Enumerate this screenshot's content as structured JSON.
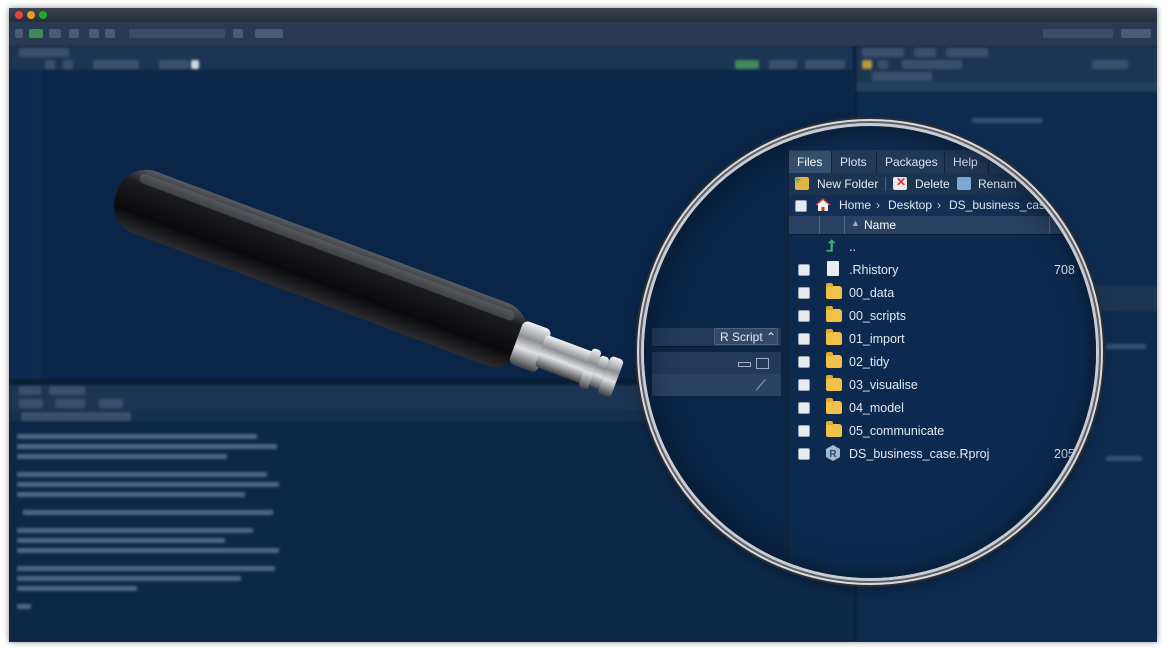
{
  "files_pane": {
    "tabs": [
      "Files",
      "Plots",
      "Packages",
      "Help"
    ],
    "toolbar": {
      "new_folder": "New Folder",
      "delete": "Delete",
      "rename": "Renam"
    },
    "breadcrumb": [
      "Home",
      "Desktop",
      "DS_business_case"
    ],
    "column_header": {
      "name": "Name"
    },
    "rows": [
      {
        "name": "..",
        "size": "",
        "icon": "up-arrow-icon"
      },
      {
        "name": ".Rhistory",
        "size": "708",
        "icon": "document-icon"
      },
      {
        "name": "00_data",
        "size": "",
        "icon": "folder-icon"
      },
      {
        "name": "00_scripts",
        "size": "",
        "icon": "folder-icon"
      },
      {
        "name": "01_import",
        "size": "",
        "icon": "folder-icon"
      },
      {
        "name": "02_tidy",
        "size": "",
        "icon": "folder-icon"
      },
      {
        "name": "03_visualise",
        "size": "",
        "icon": "folder-icon"
      },
      {
        "name": "04_model",
        "size": "",
        "icon": "folder-icon"
      },
      {
        "name": "05_communicate",
        "size": "",
        "icon": "folder-icon"
      },
      {
        "name": "DS_business_case.Rproj",
        "size": "205",
        "icon": "rproj-icon"
      }
    ]
  },
  "editor": {
    "script_type": "R Script"
  },
  "colors": {
    "background": "#0f2c52",
    "folder": "#f0c24a",
    "up_arrow": "#3cb371"
  }
}
